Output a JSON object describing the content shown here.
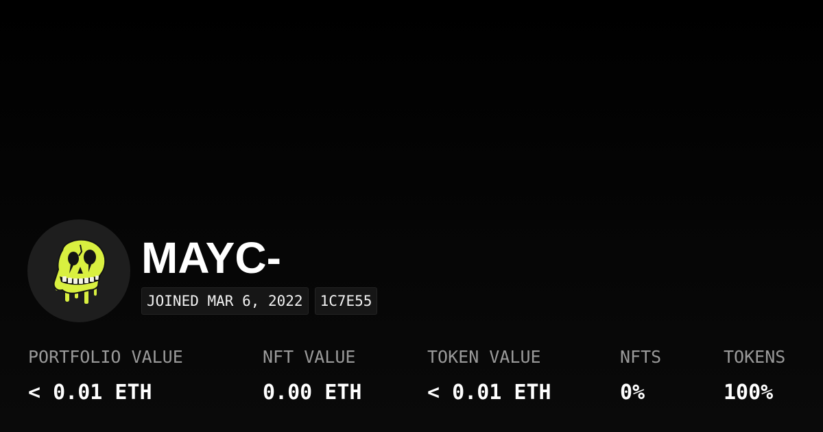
{
  "profile": {
    "avatar_icon": "mutant-ape-skull-icon",
    "avatar_color": "#d9f040",
    "name": "MAYC-",
    "joined": "JOINED MAR 6, 2022",
    "address_short": "1C7E55"
  },
  "stats": [
    {
      "label": "PORTFOLIO VALUE",
      "value": "< 0.01 ETH"
    },
    {
      "label": "NFT VALUE",
      "value": "0.00 ETH"
    },
    {
      "label": "TOKEN VALUE",
      "value": "< 0.01 ETH"
    },
    {
      "label": "NFTS",
      "value": "0%"
    },
    {
      "label": "TOKENS",
      "value": "100%"
    }
  ]
}
